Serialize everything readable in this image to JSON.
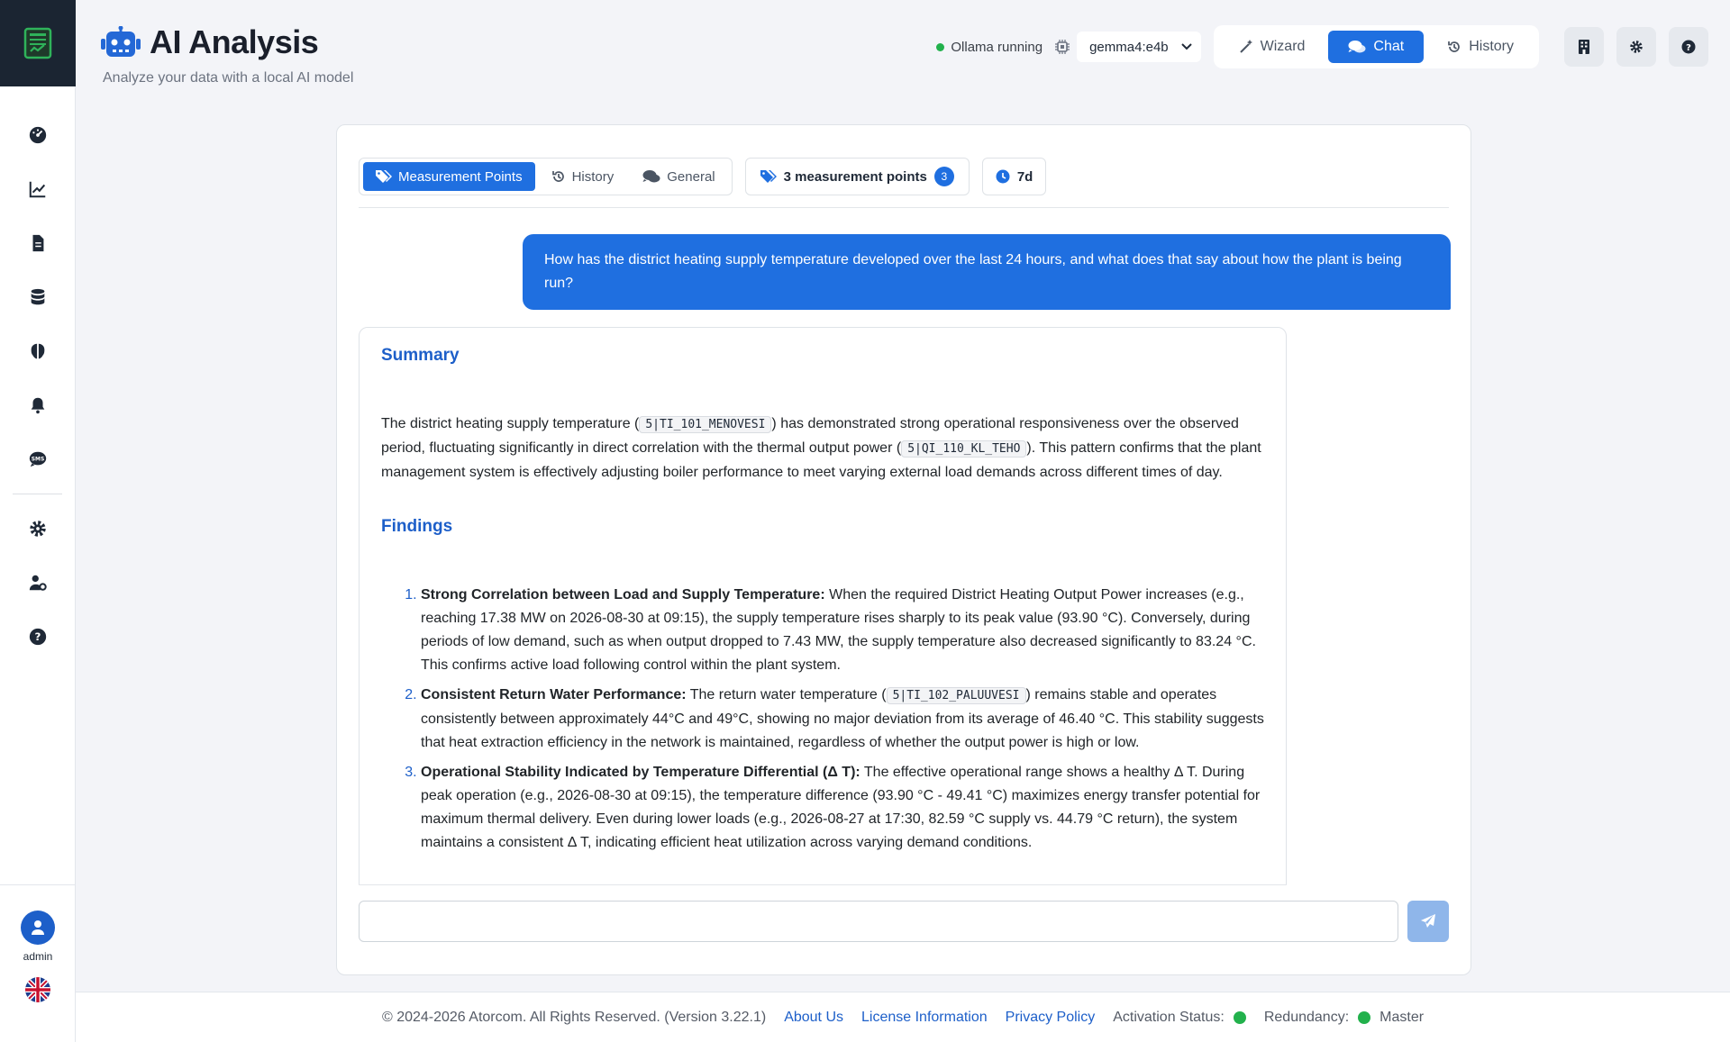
{
  "header": {
    "title": "AI Analysis",
    "subtitle": "Analyze your data with a local AI model"
  },
  "topbar": {
    "status_text": "Ollama running",
    "model_selected": "gemma4:e4b",
    "modes": [
      {
        "label": "Wizard",
        "icon": "wand-icon"
      },
      {
        "label": "Chat",
        "icon": "comments-icon",
        "active": true
      },
      {
        "label": "History",
        "icon": "history-icon"
      }
    ]
  },
  "context": {
    "tabs": [
      {
        "label": "Measurement Points",
        "icon": "tags-icon",
        "active": true
      },
      {
        "label": "History",
        "icon": "history-icon"
      },
      {
        "label": "General",
        "icon": "comments-icon"
      }
    ],
    "points_label": "3 measurement points",
    "points_count": "3",
    "range_label": "7d"
  },
  "chat": {
    "user_message": "How has the district heating supply temperature developed over the last 24 hours, and what does that say about how the plant is being run?",
    "summary_heading": "Summary",
    "summary": {
      "t1": "The district heating supply temperature (",
      "c1": "5|TI_101_MENOVESI",
      "t2": ") has demonstrated strong operational responsiveness over the observed period, fluctuating significantly in direct correlation with the thermal output power (",
      "c2": "5|QI_110_KL_TEHO",
      "t3": "). This pattern confirms that the plant management system is effectively adjusting boiler performance to meet varying external load demands across different times of day."
    },
    "findings_heading": "Findings",
    "findings": [
      {
        "title": "Strong Correlation between Load and Supply Temperature:",
        "text": " When the required District Heating Output Power increases (e.g., reaching 17.38 MW on 2026-08-30 at 09:15), the supply temperature rises sharply to its peak value (93.90 °C). Conversely, during periods of low demand, such as when output dropped to 7.43 MW, the supply temperature also decreased significantly to 83.24 °C. This confirms active load following control within the plant system."
      },
      {
        "title": "Consistent Return Water Performance:",
        "text_a": " The return water temperature (",
        "code": "5|TI_102_PALUUVESI",
        "text_b": ") remains stable and operates consistently between approximately 44°C and 49°C, showing no major deviation from its average of 46.40 °C. This stability suggests that heat extraction efficiency in the network is maintained, regardless of whether the output power is high or low."
      },
      {
        "title": "Operational Stability Indicated by Temperature Differential (Δ T):",
        "text": " The effective operational range shows a healthy Δ T. During peak operation (e.g., 2026-08-30 at 09:15), the temperature difference (93.90 °C - 49.41 °C) maximizes energy transfer potential for maximum thermal delivery. Even during lower loads (e.g., 2026-08-27 at 17:30, 82.59 °C supply vs. 44.79 °C return), the system maintains a consistent Δ T, indicating efficient heat utilization across varying demand conditions."
      }
    ],
    "input_placeholder": ""
  },
  "sidebar": {
    "items": [
      "dashboard-icon",
      "chart-line-icon",
      "file-icon",
      "database-icon",
      "brain-icon",
      "bell-icon",
      "sms-icon",
      "gear-icon",
      "user-gear-icon",
      "help-icon"
    ],
    "user": "admin"
  },
  "footer": {
    "copyright": "© 2024-2026 Atorcom. All Rights Reserved. (Version 3.22.1)",
    "about": "About Us",
    "license": "License Information",
    "privacy": "Privacy Policy",
    "activation_label": "Activation Status:",
    "redundancy_label": "Redundancy:",
    "redundancy_value": "Master"
  },
  "colors": {
    "accent": "#1f6fe0",
    "status_ok": "#22b14c",
    "heading_blue": "#1d5fc9"
  }
}
